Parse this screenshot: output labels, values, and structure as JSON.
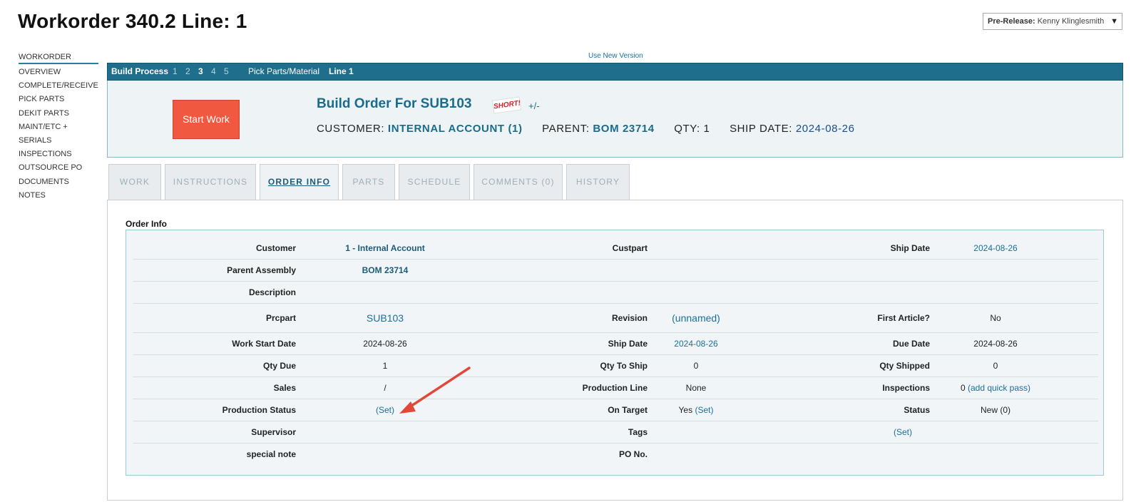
{
  "page": {
    "title": "Workorder 340.2 Line: 1",
    "user_label": "Pre-Release:",
    "user_name": "Kenny Klinglesmith",
    "use_new_version": "Use New Version"
  },
  "leftnav": {
    "items": [
      "WORKORDER",
      "OVERVIEW",
      "COMPLETE/RECEIVE",
      "PICK PARTS",
      "DEKIT PARTS",
      "MAINT/ETC +",
      "SERIALS",
      "INSPECTIONS",
      "OUTSOURCE PO",
      "DOCUMENTS",
      "NOTES"
    ],
    "active": "WORKORDER"
  },
  "process_bar": {
    "label": "Build Process",
    "steps": [
      "1",
      "2",
      "3",
      "4",
      "5"
    ],
    "current_step": "3",
    "pick": "Pick Parts/Material",
    "line": "Line 1"
  },
  "header": {
    "start_button": "Start Work",
    "build_title": "Build Order For SUB103",
    "short_badge": "SHORT!",
    "plus_minus": "+/-",
    "customer_label": "CUSTOMER:",
    "customer_value": "INTERNAL ACCOUNT (1)",
    "parent_label": "PARENT:",
    "parent_value": "BOM 23714",
    "qty_label": "QTY: 1",
    "ship_label": "SHIP DATE:",
    "ship_value": "2024-08-26"
  },
  "tabs": [
    "WORK",
    "INSTRUCTIONS",
    "ORDER INFO",
    "PARTS",
    "SCHEDULE",
    "COMMENTS (0)",
    "HISTORY"
  ],
  "active_tab": "ORDER INFO",
  "order_info": {
    "title": "Order Info",
    "customer_label": "Customer",
    "customer_value": "1 - Internal Account",
    "custpart_label": "Custpart",
    "ship_date_label": "Ship Date",
    "ship_date_value": "2024-08-26",
    "parent_label": "Parent Assembly",
    "parent_value": "BOM 23714",
    "description_label": "Description",
    "prcpart_label": "Prcpart",
    "prcpart_value": "SUB103",
    "revision_label": "Revision",
    "revision_value": "(unnamed)",
    "first_article_label": "First Article?",
    "first_article_value": "No",
    "work_start_label": "Work Start Date",
    "work_start_value": "2024-08-26",
    "ship_date2_label": "Ship Date",
    "ship_date2_value": "2024-08-26",
    "due_date_label": "Due Date",
    "due_date_value": "2024-08-26",
    "qty_due_label": "Qty Due",
    "qty_due_value": "1",
    "qty_to_ship_label": "Qty To Ship",
    "qty_to_ship_value": "0",
    "qty_shipped_label": "Qty Shipped",
    "qty_shipped_value": "0",
    "sales_label": "Sales",
    "sales_value": "/",
    "production_line_label": "Production Line",
    "production_line_value": "None",
    "inspections_label": "Inspections",
    "inspections_count": "0",
    "inspections_link": "(add quick pass)",
    "production_status_label": "Production Status",
    "production_status_link": "(Set)",
    "on_target_label": "On Target",
    "on_target_value": "Yes",
    "on_target_link": "(Set)",
    "status_label": "Status",
    "status_value": "New (0)",
    "supervisor_label": "Supervisor",
    "tags_label": "Tags",
    "tags_link": "(Set)",
    "special_note_label": "special note",
    "po_no_label": "PO No."
  },
  "colors": {
    "accent": "#1f6e8c",
    "start_button": "#f0593f",
    "annotation_arrow": "#e2483a"
  }
}
